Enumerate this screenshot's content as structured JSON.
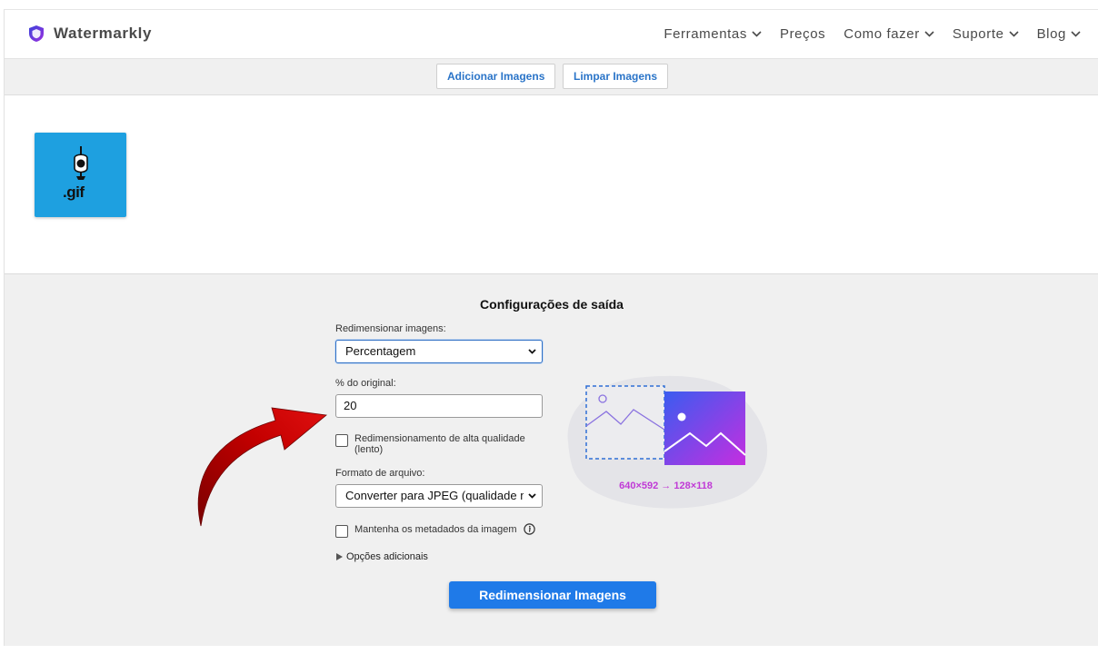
{
  "header": {
    "brand": "Watermarkly",
    "nav": [
      {
        "label": "Ferramentas",
        "has_dropdown": true
      },
      {
        "label": "Preços",
        "has_dropdown": false
      },
      {
        "label": "Como fazer",
        "has_dropdown": true
      },
      {
        "label": "Suporte",
        "has_dropdown": true
      },
      {
        "label": "Blog",
        "has_dropdown": true
      }
    ]
  },
  "toolbar": {
    "add_images": "Adicionar Imagens",
    "clear_images": "Limpar Imagens"
  },
  "images": [
    {
      "label": ".gif",
      "icon": "gif-file-icon",
      "bg_color": "#1ea0e0"
    }
  ],
  "settings": {
    "title": "Configurações de saída",
    "resize_label": "Redimensionar imagens:",
    "resize_value": "Percentagem",
    "percent_label": "% do original:",
    "percent_value": "20",
    "high_quality_label": "Redimensionamento de alta qualidade",
    "high_quality_label_2": "(lento)",
    "high_quality_checked": false,
    "format_label": "Formato de arquivo:",
    "format_value": "Converter para JPEG (qualidade máxima)",
    "keep_metadata_label": "Mantenha os metadados da imagem",
    "keep_metadata_checked": false,
    "additional_options": "Opções adicionais",
    "submit": "Redimensionar Imagens"
  },
  "illustration": {
    "dims_text": "640×592 → 128×118",
    "accent_color": "#c03ad6"
  },
  "colors": {
    "primary": "#1f7ae8",
    "link": "#2a74c8",
    "logo": "#6a3de8",
    "arrow": "#b00000"
  }
}
